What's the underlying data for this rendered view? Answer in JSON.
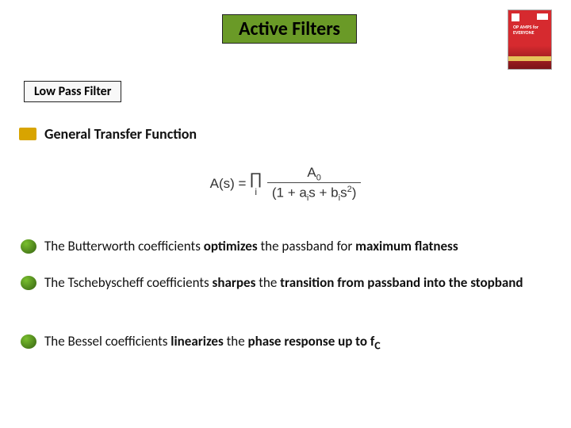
{
  "title": "Active Filters",
  "section": "Low Pass Filter",
  "heading": "General Transfer Function",
  "equation": {
    "lhs": "A(s) =",
    "prod_index": "i",
    "numerator": "A",
    "numerator_sub": "0",
    "denom_left": "(1  +  a",
    "denom_sub1": "i",
    "denom_mid": "s  +  b",
    "denom_sub2": "i",
    "denom_s": "s",
    "denom_sup": "2",
    "denom_right": ")"
  },
  "bullets": [
    {
      "pre": "The Butterworth coefficients ",
      "bold1": "optimizes",
      "mid": " the passband for ",
      "bold2": "maximum flatness",
      "post": ""
    },
    {
      "pre": "The Tschebyscheff coefficients ",
      "bold1": "sharpes",
      "mid": " the ",
      "bold2": "transition from passband into the stopband",
      "post": ""
    },
    {
      "pre": "The Bessel coefficients ",
      "bold1": "linearizes",
      "mid": " the ",
      "bold2": "phase response up to f",
      "post": "",
      "sub": "C"
    }
  ],
  "book": {
    "line1": "OP AMPS for",
    "line2": "EVERYONE"
  }
}
